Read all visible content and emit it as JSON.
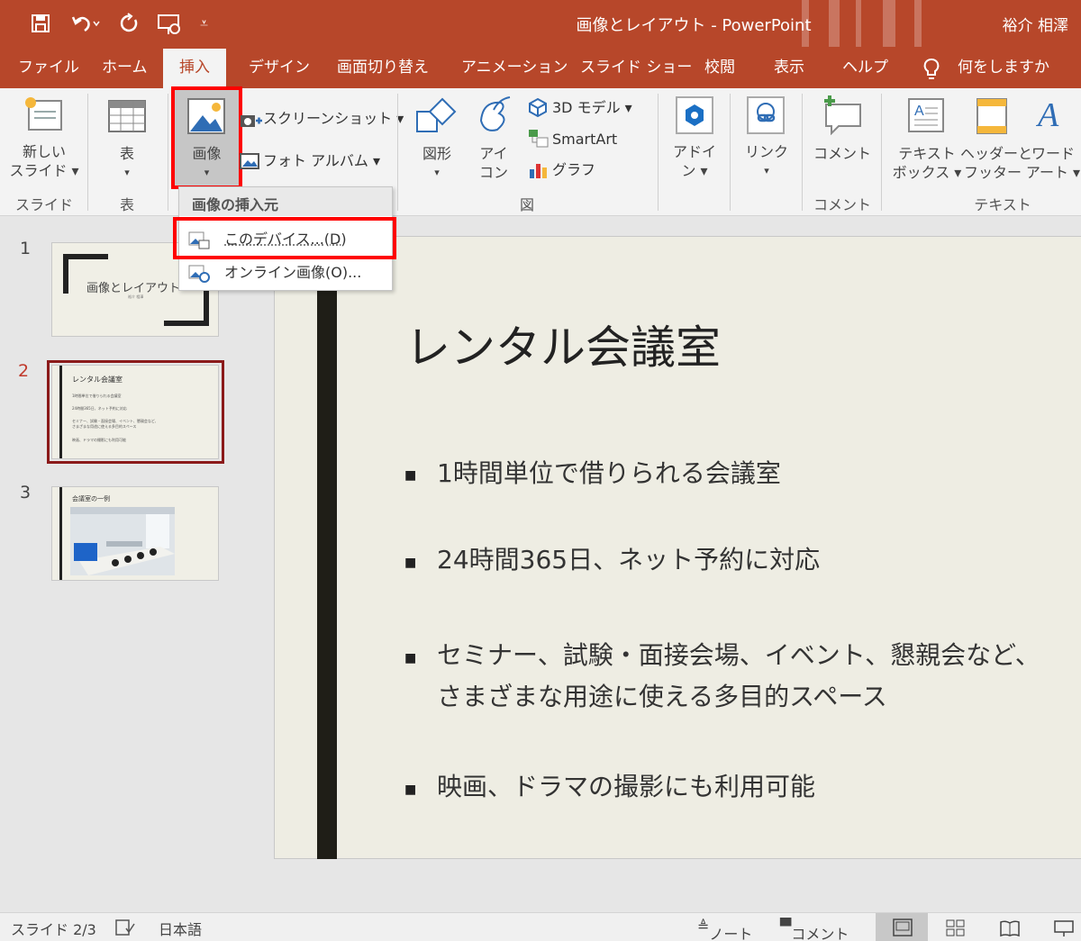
{
  "window": {
    "title": "画像とレイアウト - PowerPoint",
    "user": "裕介 相澤"
  },
  "quick_access": [
    "save-icon",
    "undo-icon",
    "redo-icon",
    "present-icon",
    "customize-icon"
  ],
  "tabs": [
    "ファイル",
    "ホーム",
    "挿入",
    "デザイン",
    "画面切り替え",
    "アニメーション",
    "スライド ショー",
    "校閲",
    "表示",
    "ヘルプ",
    "何をしますか"
  ],
  "active_tab": "挿入",
  "ribbon": {
    "new_slide": [
      "新しい",
      "スライド ▾"
    ],
    "table": [
      "表",
      "▾"
    ],
    "image": [
      "画像",
      "▾"
    ],
    "screenshot": "スクリーンショット ▾",
    "photo_album": "フォト アルバム ▾",
    "shapes": [
      "図形",
      "▾"
    ],
    "icons": [
      "アイ",
      "コン"
    ],
    "model3d": "3D モデル ▾",
    "smartart": "SmartArt",
    "chart": "グラフ",
    "addin": [
      "アドイ",
      "ン ▾"
    ],
    "link": [
      "リンク",
      "▾"
    ],
    "comment": "コメント",
    "textbox": [
      "テキスト",
      "ボックス ▾"
    ],
    "header_footer": [
      "ヘッダーと",
      "フッター"
    ],
    "wordart": [
      "ワード",
      "アート ▾"
    ],
    "groups": {
      "slides": "スライド",
      "table": "表",
      "illustrations": "図",
      "comments": "コメント",
      "text": "テキスト"
    }
  },
  "dropdown": {
    "header": "画像の挿入元",
    "items": [
      "このデバイス...(D)",
      "オンライン画像(O)..."
    ]
  },
  "thumbnails": [
    {
      "num": "1",
      "text": "画像とレイアウト",
      "sub": "裕介 相澤"
    },
    {
      "num": "2",
      "text": "レンタル会議室",
      "lines": [
        "1時間単位で借りられる会議室",
        "24時間365日、ネット予約に対応",
        "セミナー、試験・面接会場、イベント、懇親会など、",
        "さまざまな用途に使える多目的スペース",
        "映画、ドラマの撮影にも利用可能"
      ]
    },
    {
      "num": "3",
      "text": "会議室の一例"
    }
  ],
  "slide": {
    "title": "レンタル会議室",
    "bullets": [
      [
        "1時間単位で借りられる会議室"
      ],
      [
        "24時間365日、ネット予約に対応"
      ],
      [
        "セミナー、試験・面接会場、イベント、懇親会など、",
        "さまざまな用途に使える多目的スペース"
      ],
      [
        "映画、ドラマの撮影にも利用可能"
      ]
    ]
  },
  "status": {
    "slide": "スライド 2/3",
    "lang": "日本語",
    "notes": "ノート",
    "comments": "コメント"
  },
  "colors": {
    "accent": "#b7472a",
    "highlight": "#ff0000",
    "selected_thumb": "#8b1a1a",
    "slide_bg": "#eeede3",
    "slide_bar": "#1f1e17"
  }
}
